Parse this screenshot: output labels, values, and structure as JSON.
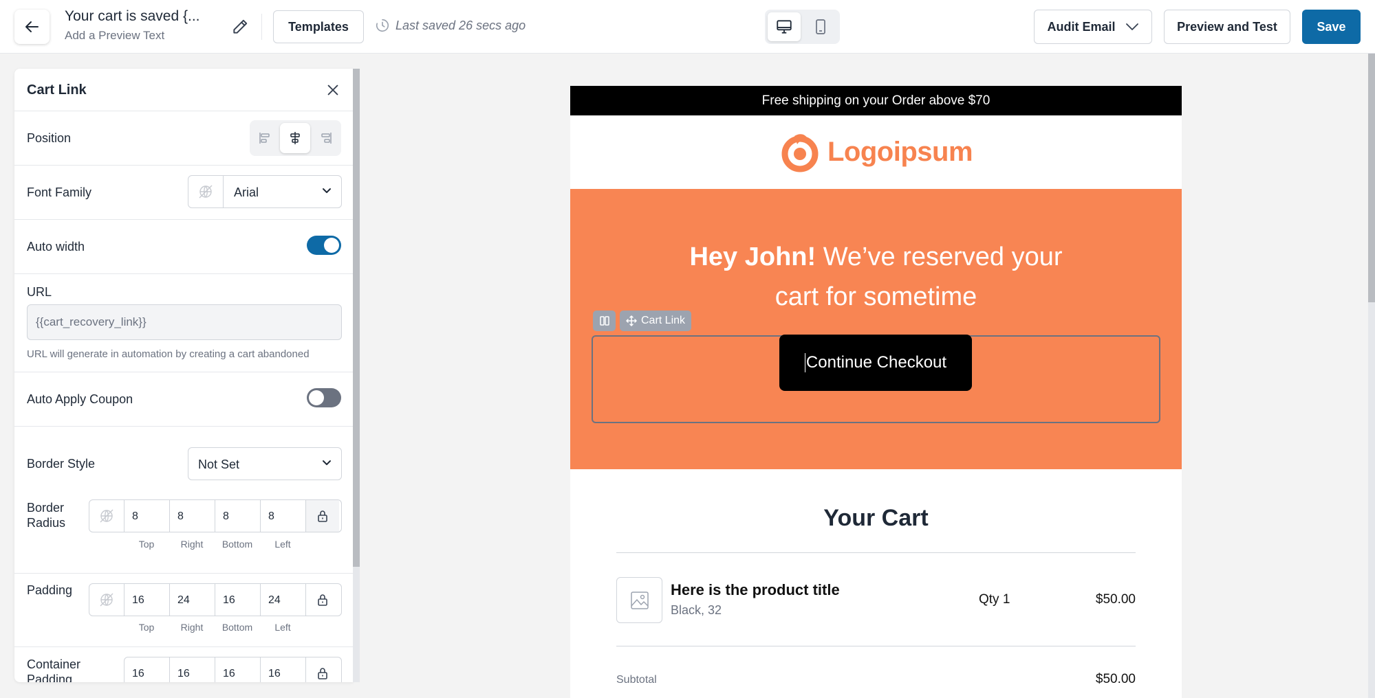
{
  "topbar": {
    "title": "Your cart is saved {...",
    "preview_text": "Add a Preview Text",
    "templates_label": "Templates",
    "last_saved": "Last saved 26 secs ago",
    "audit_label": "Audit Email",
    "preview_label": "Preview and Test",
    "save_label": "Save",
    "save_color": "#0e6aa6"
  },
  "panel": {
    "title": "Cart Link",
    "position_label": "Position",
    "position_value": "center",
    "font_family_label": "Font Family",
    "font_family_value": "Arial",
    "auto_width_label": "Auto width",
    "auto_width_on": true,
    "url_label": "URL",
    "url_value": "{{cart_recovery_link}}",
    "url_help": "URL will generate in automation by creating a cart abandoned",
    "auto_coupon_label": "Auto Apply Coupon",
    "auto_coupon_on": false,
    "border_style_label": "Border Style",
    "border_style_value": "Not Set",
    "border_radius_label_1": "Border",
    "border_radius_label_2": "Radius",
    "border_radius": [
      "8",
      "8",
      "8",
      "8"
    ],
    "padding_label": "Padding",
    "padding": [
      "16",
      "24",
      "16",
      "24"
    ],
    "container_padding_label_1": "Container",
    "container_padding_label_2": "Padding",
    "container_padding": [
      "16",
      "16",
      "16",
      "16"
    ],
    "side_labels": [
      "Top",
      "Right",
      "Bottom",
      "Left"
    ]
  },
  "email": {
    "announcement": "Free shipping on your Order above $70",
    "logo_text": "Logoipsum",
    "brand_color": "#f88553",
    "hero_bold": "Hey John!",
    "hero_line1_rest": " We’ve reserved your",
    "hero_line2": "cart for sometime",
    "selected_block_label": "Cart Link",
    "button_label": "Continue Checkout",
    "cart_title": "Your Cart",
    "product_title": "Here is the product title",
    "product_variant": "Black, 32",
    "product_qty": "Qty 1",
    "product_price": "$50.00",
    "subtotal_label": "Subtotal",
    "subtotal_value": "$50.00"
  }
}
